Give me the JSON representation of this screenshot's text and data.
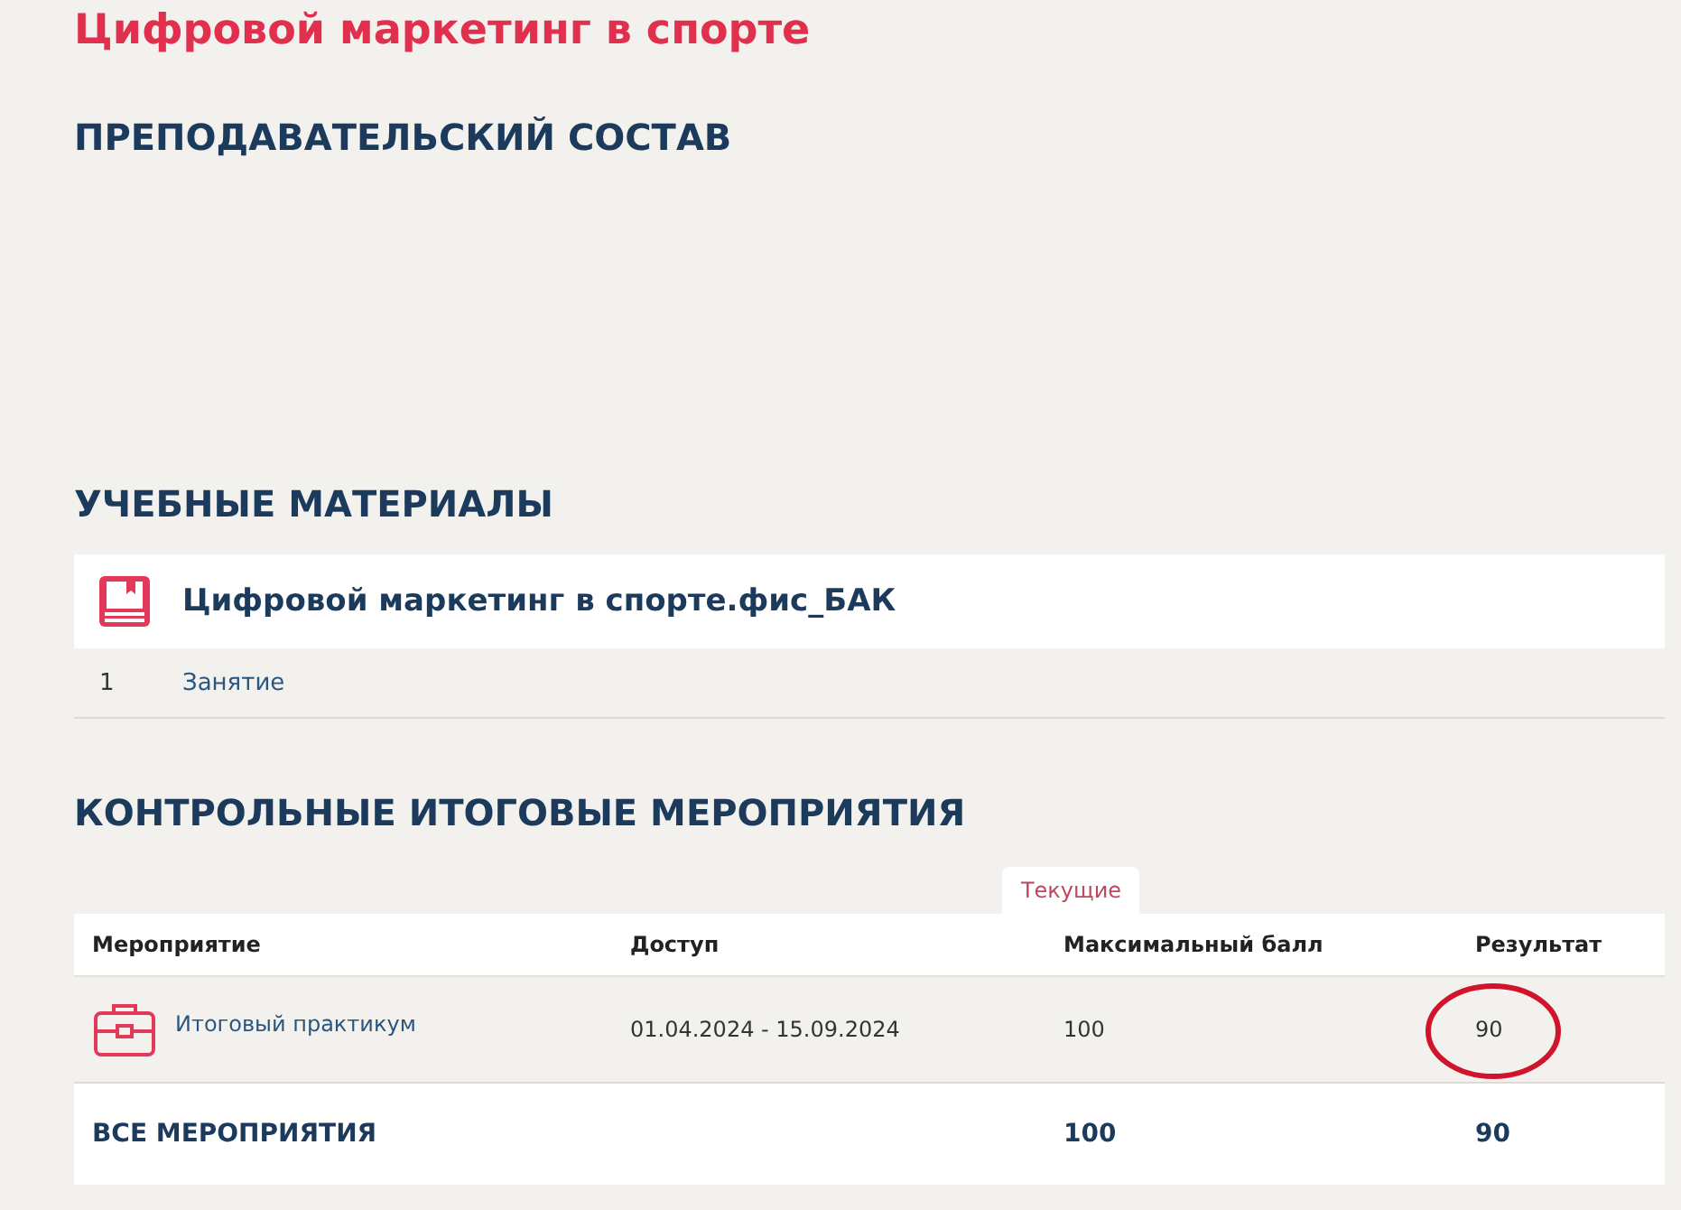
{
  "course_title": "Цифровой маркетинг в спорте",
  "teachers": {
    "heading": "ПРЕПОДАВАТЕЛЬСКИЙ СОСТАВ"
  },
  "materials": {
    "heading": "УЧЕБНЫЕ МАТЕРИАЛЫ",
    "book": {
      "title": "Цифровой маркетинг в спорте.фис_БАК"
    },
    "items": [
      {
        "number": "1",
        "title": "Занятие"
      }
    ]
  },
  "final_events": {
    "heading": "КОНТРОЛЬНЫЕ ИТОГОВЫЕ МЕРОПРИЯТИЯ",
    "tabs": [
      {
        "label": "Текущие",
        "selected": true
      }
    ],
    "table": {
      "columns": [
        "Мероприятие",
        "Доступ",
        "Максимальный балл",
        "Результат"
      ],
      "rows": [
        {
          "name": "Итоговый практикум",
          "access": "01.04.2024 - 15.09.2024",
          "max_score": "100",
          "result": "90",
          "circled": true
        }
      ],
      "total": {
        "label": "ВСЕ МЕРОПРИЯТИЯ",
        "max_score": "100",
        "result": "90"
      }
    }
  }
}
